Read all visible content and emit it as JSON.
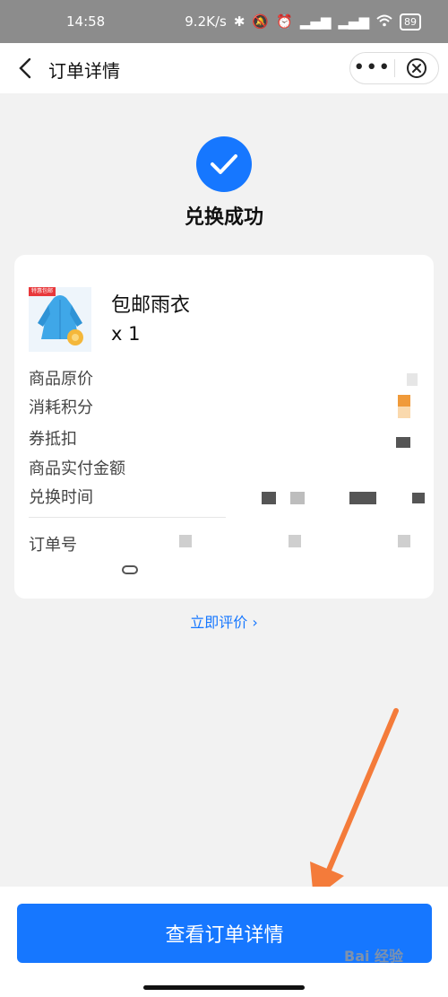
{
  "status_bar": {
    "time": "14:58",
    "network_speed": "9.2K/s",
    "battery": "89",
    "icons": [
      "bluetooth-icon",
      "mute-icon",
      "alarm-icon",
      "signal-icon",
      "signal-icon",
      "wifi-icon",
      "battery-icon"
    ]
  },
  "nav": {
    "title": "订单详情",
    "more_label": "•••"
  },
  "success": {
    "text": "兑换成功"
  },
  "product": {
    "tag": "特惠包邮",
    "name": "包邮雨衣",
    "quantity": "x 1"
  },
  "details": {
    "rows": [
      {
        "label": "商品原价"
      },
      {
        "label": "消耗积分"
      },
      {
        "label": "券抵扣"
      },
      {
        "label": "商品实付金额"
      },
      {
        "label": "兑换时间"
      },
      {
        "label": "订单号"
      }
    ]
  },
  "review_link": "立即评价",
  "primary_button": "查看订单详情",
  "watermark": "Bai 经验",
  "colors": {
    "accent": "#1677ff",
    "annotation_arrow": "#f47b3a"
  }
}
